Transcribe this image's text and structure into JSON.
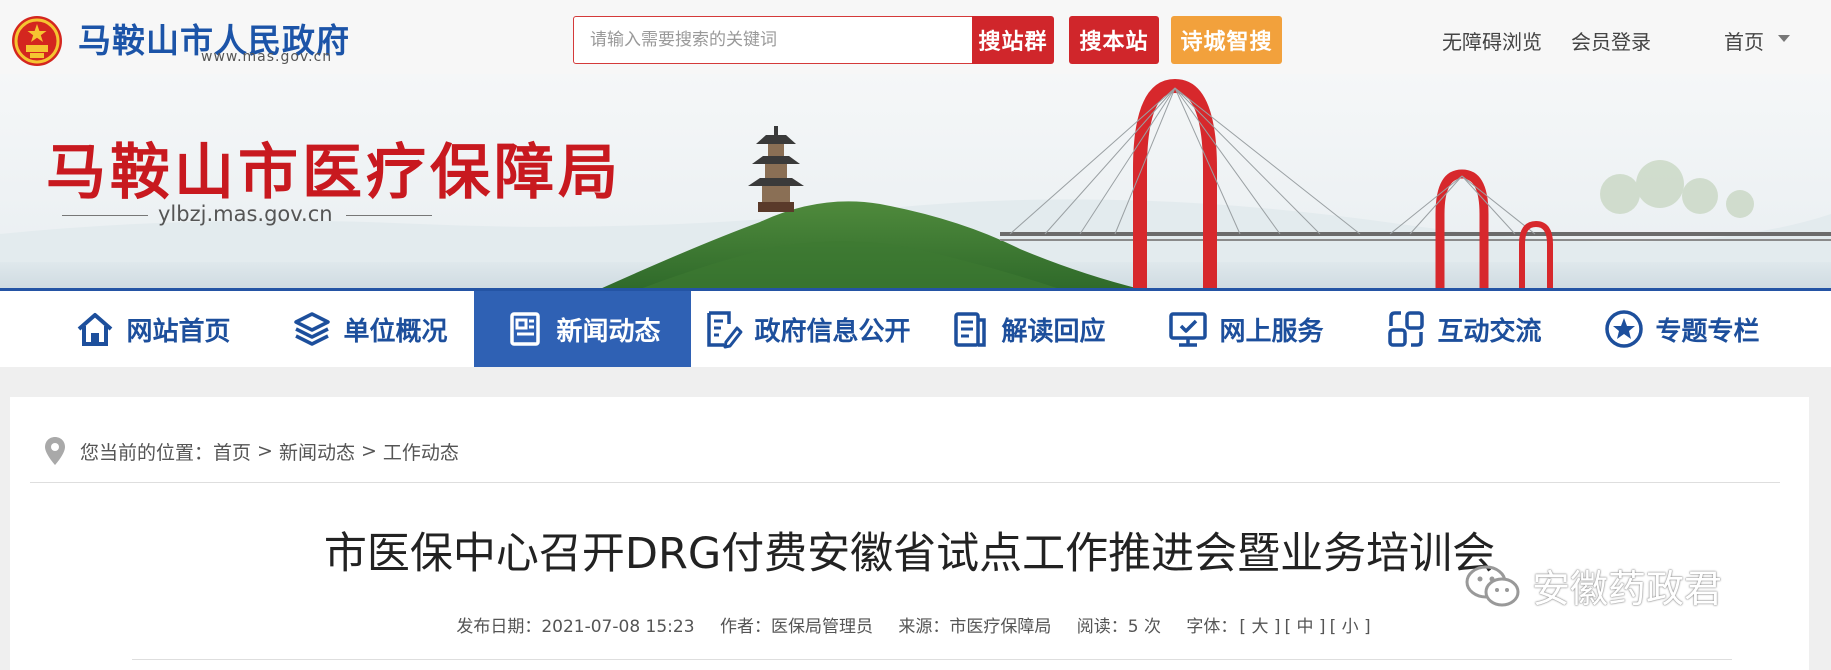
{
  "header": {
    "gov_name": "马鞍山市人民政府",
    "gov_url": "www.mas.gov.cn",
    "search": {
      "placeholder": "请输入需要搜索的关键词",
      "value": ""
    },
    "buttons": {
      "search_group": "搜站群",
      "search_site": "搜本站",
      "poem_search": "诗城智搜"
    },
    "links": {
      "accessible": "无障碍浏览",
      "member_login": "会员登录",
      "home": "首页"
    }
  },
  "banner": {
    "title": "马鞍山市医疗保障局",
    "url": "ylbzj.mas.gov.cn"
  },
  "nav": {
    "items": [
      {
        "label": "网站首页",
        "icon": "home-icon",
        "active": false
      },
      {
        "label": "单位概况",
        "icon": "layers-icon",
        "active": false
      },
      {
        "label": "新闻动态",
        "icon": "news-icon",
        "active": true
      },
      {
        "label": "政府信息公开",
        "icon": "document-edit-icon",
        "active": false
      },
      {
        "label": "解读回应",
        "icon": "clipboard-icon",
        "active": false
      },
      {
        "label": "网上服务",
        "icon": "monitor-icon",
        "active": false
      },
      {
        "label": "互动交流",
        "icon": "exchange-icon",
        "active": false
      },
      {
        "label": "专题专栏",
        "icon": "star-circle-icon",
        "active": false
      }
    ]
  },
  "breadcrumb": {
    "prefix": "您当前的位置：",
    "items": [
      "首页",
      "新闻动态",
      "工作动态"
    ],
    "separator": ">"
  },
  "article": {
    "title": "市医保中心召开DRG付费安徽省试点工作推进会暨业务培训会",
    "meta": {
      "date": "发布日期：2021-07-08 15:23",
      "author": "作者：医保局管理员",
      "source": "来源：市医疗保障局",
      "reads": "阅读：5 次",
      "font_label": "字体：",
      "font_sizes": [
        "[ 大 ]",
        "[ 中 ]",
        "[ 小 ]"
      ]
    }
  },
  "watermark": "安徽药政君",
  "colors": {
    "brand_blue": "#1d4f9c",
    "nav_active": "#2f61b4",
    "red": "#d0262b",
    "orange": "#f2a13c",
    "banner_red": "#c8191f"
  }
}
